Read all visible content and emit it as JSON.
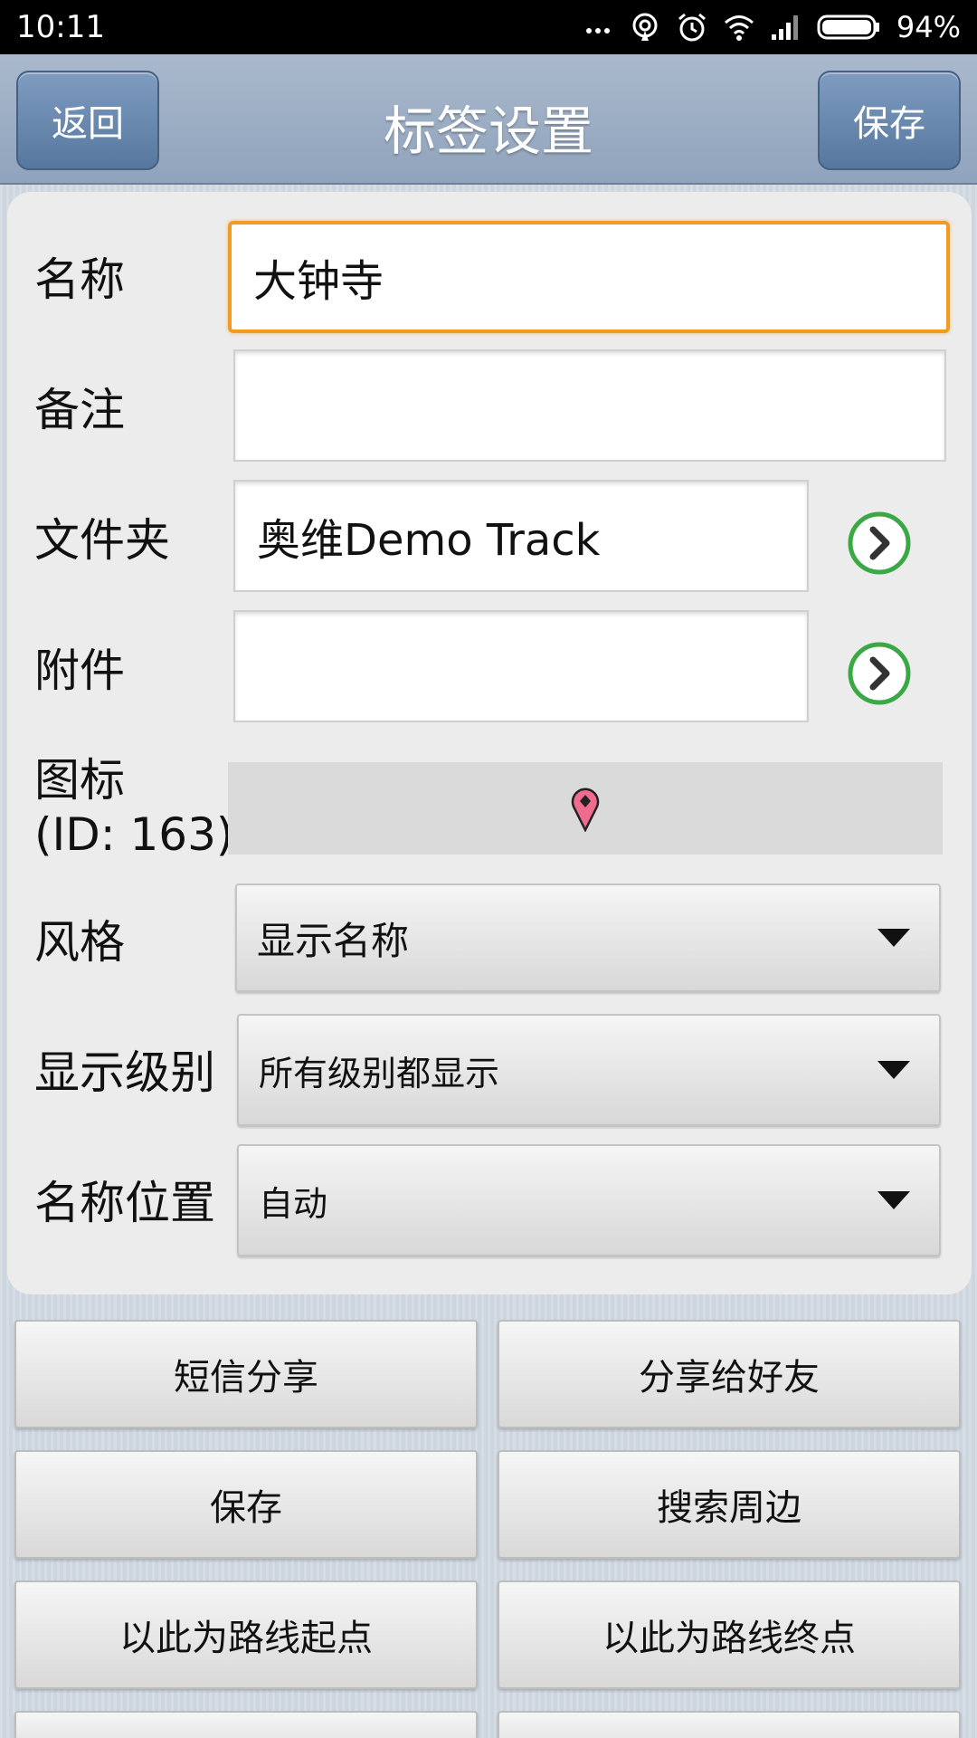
{
  "status_bar": {
    "time": "10:11",
    "battery_percent": "94%",
    "icons": [
      "more-dots-icon",
      "hotspot-icon",
      "alarm-icon",
      "wifi-icon",
      "signal-icon",
      "battery-icon"
    ]
  },
  "app_bar": {
    "back_label": "返回",
    "title": "标签设置",
    "save_label": "保存"
  },
  "form": {
    "name": {
      "label": "名称",
      "value": "大钟寺"
    },
    "note": {
      "label": "备注",
      "value": ""
    },
    "folder": {
      "label": "文件夹",
      "value": "奥维Demo Track"
    },
    "attachment": {
      "label": "附件",
      "value": ""
    },
    "icon": {
      "label_line1": "图标",
      "label_line2": "(ID: 163)",
      "icon_name": "map-pin-icon",
      "pin_color": "#f06b8e"
    },
    "style": {
      "label": "风格",
      "selected": "显示名称"
    },
    "display_level": {
      "label": "显示级别",
      "selected": "所有级别都显示"
    },
    "name_position": {
      "label": "名称位置",
      "selected": "自动"
    }
  },
  "actions": [
    {
      "label": "短信分享"
    },
    {
      "label": "分享给好友"
    },
    {
      "label": "保存"
    },
    {
      "label": "搜索周边"
    },
    {
      "label": "以此为路线起点"
    },
    {
      "label": "以此为路线终点"
    }
  ],
  "colors": {
    "focus_border": "#f39a23",
    "go_button_ring": "#3aa845",
    "app_bar_button": "#5f80a8"
  }
}
